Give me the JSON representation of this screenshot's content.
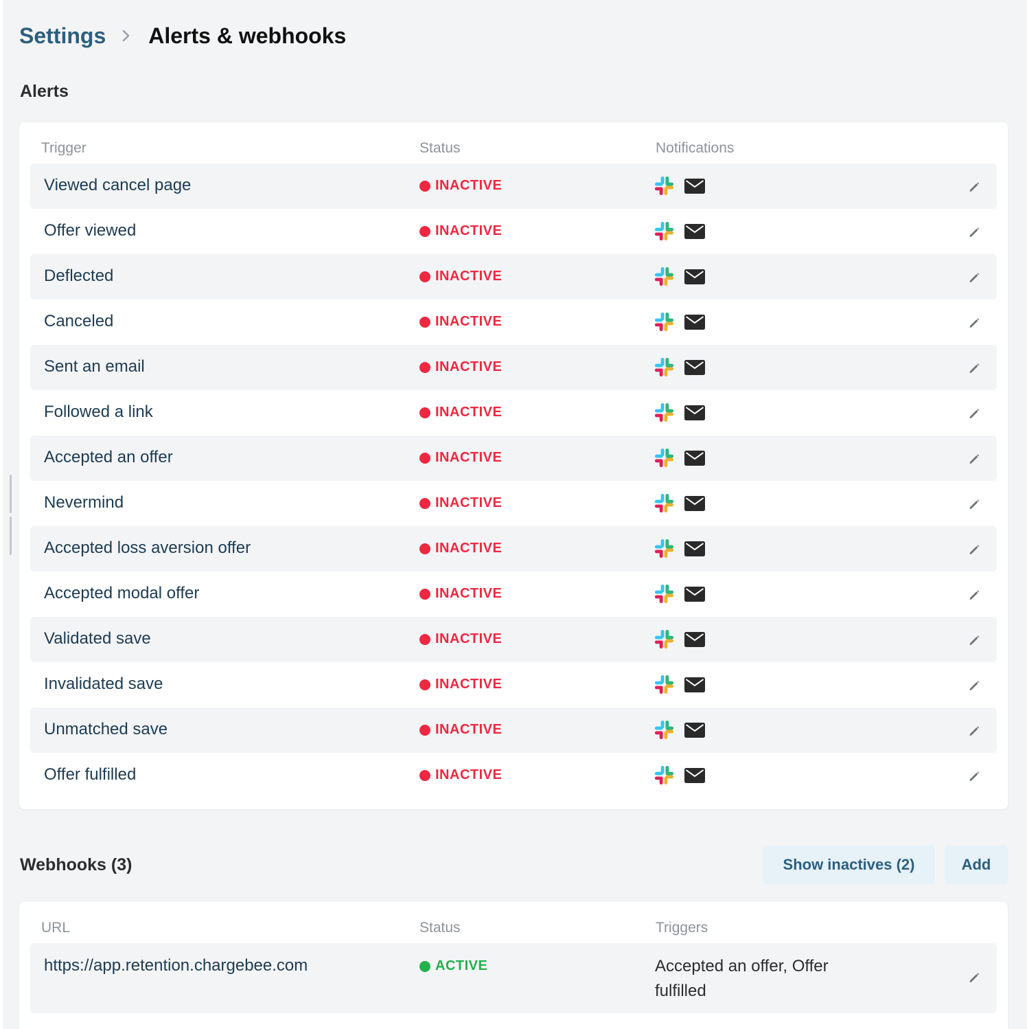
{
  "breadcrumb": {
    "parent": "Settings",
    "current": "Alerts & webhooks"
  },
  "colors": {
    "inactive": "#ee2841",
    "active": "#22b14c",
    "link": "#2b5f7f",
    "row_stripe": "#f3f4f6"
  },
  "alerts": {
    "title": "Alerts",
    "columns": {
      "trigger": "Trigger",
      "status": "Status",
      "notifications": "Notifications"
    },
    "rows": [
      {
        "trigger": "Viewed cancel page",
        "status": "INACTIVE"
      },
      {
        "trigger": "Offer viewed",
        "status": "INACTIVE"
      },
      {
        "trigger": "Deflected",
        "status": "INACTIVE"
      },
      {
        "trigger": "Canceled",
        "status": "INACTIVE"
      },
      {
        "trigger": "Sent an email",
        "status": "INACTIVE"
      },
      {
        "trigger": "Followed a link",
        "status": "INACTIVE"
      },
      {
        "trigger": "Accepted an offer",
        "status": "INACTIVE"
      },
      {
        "trigger": "Nevermind",
        "status": "INACTIVE"
      },
      {
        "trigger": "Accepted loss aversion offer",
        "status": "INACTIVE"
      },
      {
        "trigger": "Accepted modal offer",
        "status": "INACTIVE"
      },
      {
        "trigger": "Validated save",
        "status": "INACTIVE"
      },
      {
        "trigger": "Invalidated save",
        "status": "INACTIVE"
      },
      {
        "trigger": "Unmatched save",
        "status": "INACTIVE"
      },
      {
        "trigger": "Offer fulfilled",
        "status": "INACTIVE"
      }
    ],
    "notification_icons": [
      "slack-icon",
      "mail-icon"
    ],
    "row_action_icon": "pencil-icon"
  },
  "webhooks": {
    "title": "Webhooks (3)",
    "show_inactives_label": "Show inactives (2)",
    "add_label": "Add",
    "columns": {
      "url": "URL",
      "status": "Status",
      "triggers": "Triggers"
    },
    "rows": [
      {
        "url": "https://app.retention.chargebee.com",
        "status": "ACTIVE",
        "triggers": "Accepted an offer, Offer fulfilled"
      }
    ]
  }
}
